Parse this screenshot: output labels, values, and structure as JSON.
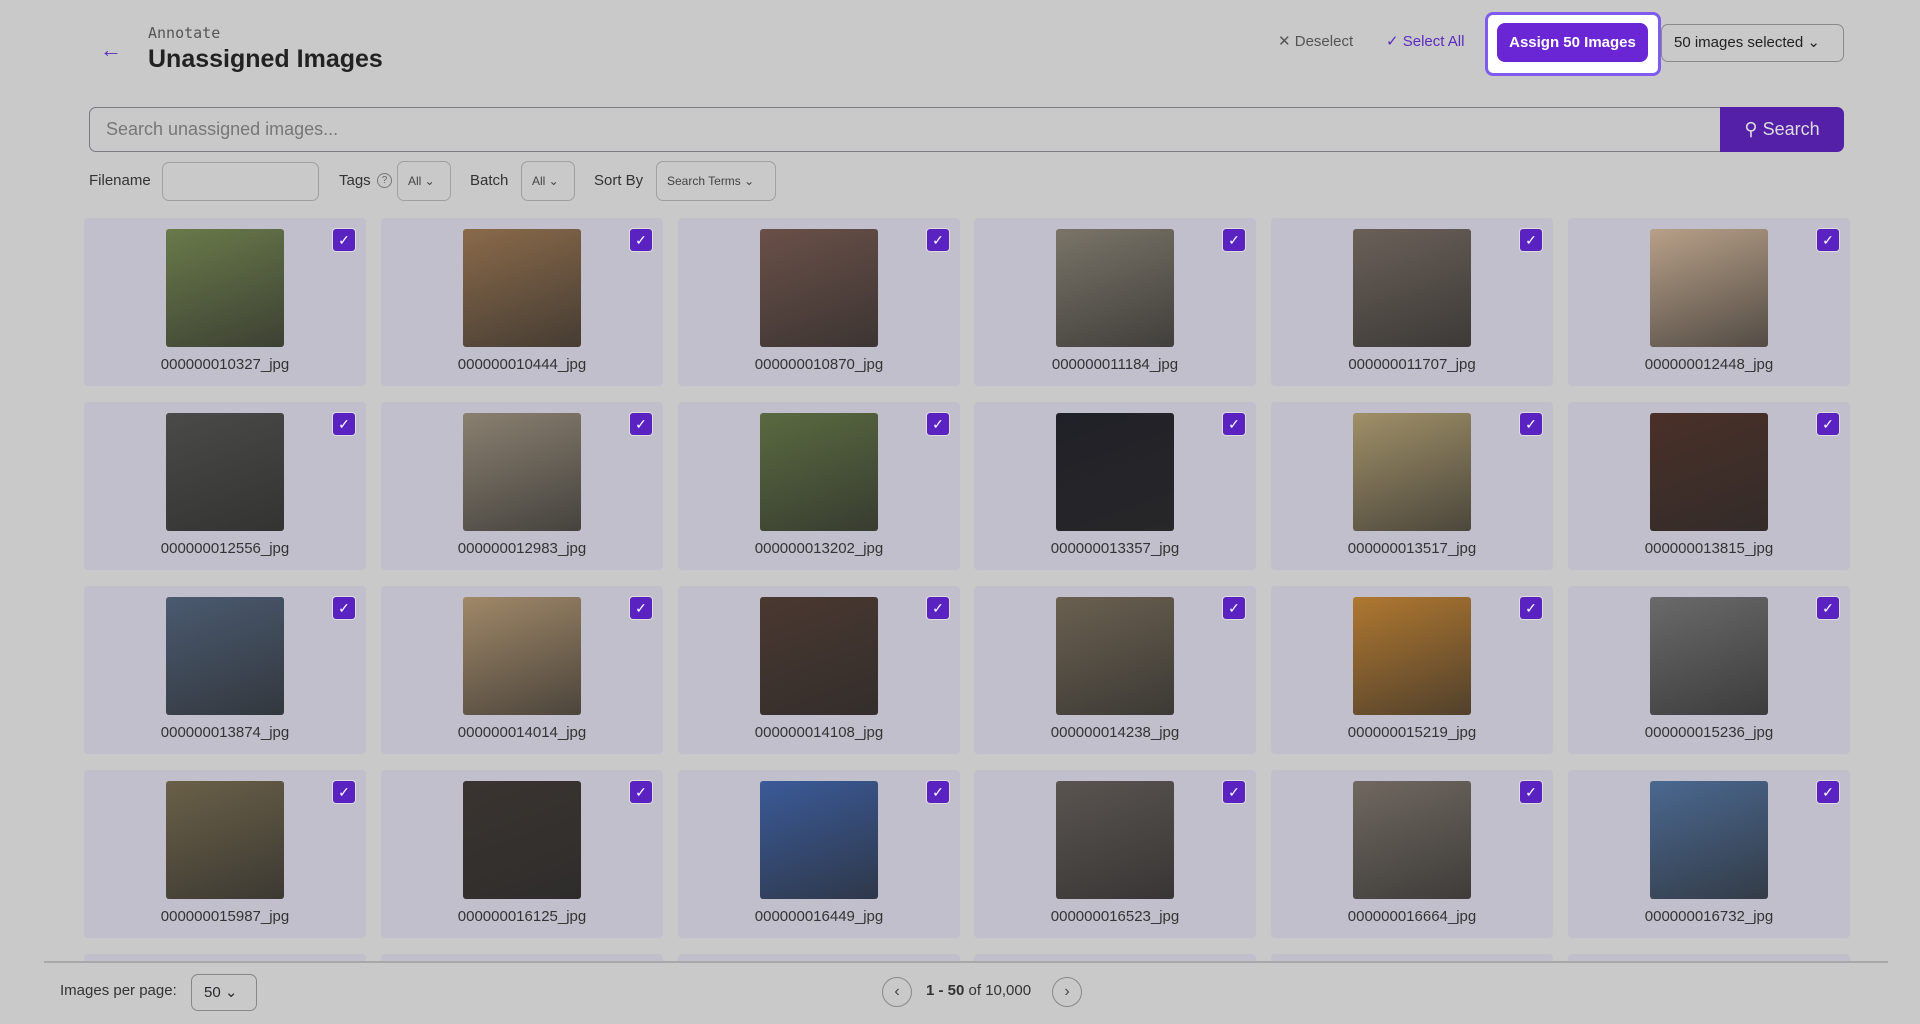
{
  "header": {
    "breadcrumb": "Annotate",
    "title": "Unassigned Images",
    "deselect": "Deselect",
    "select_all": "Select All",
    "assign": "Assign 50 Images",
    "selected": "50 images selected"
  },
  "search": {
    "placeholder": "Search unassigned images...",
    "button": "Search"
  },
  "filters": {
    "filename_label": "Filename",
    "tags_label": "Tags",
    "tags_value": "All",
    "batch_label": "Batch",
    "batch_value": "All",
    "sort_label": "Sort By",
    "sort_value": "Search Terms"
  },
  "images": [
    {
      "name": "000000010327_jpg",
      "color": "#6a7a4a"
    },
    {
      "name": "000000010444_jpg",
      "color": "#8a6a4a"
    },
    {
      "name": "000000010870_jpg",
      "color": "#6a5048"
    },
    {
      "name": "000000011184_jpg",
      "color": "#7a7468"
    },
    {
      "name": "000000011707_jpg",
      "color": "#6a6058"
    },
    {
      "name": "000000012448_jpg",
      "color": "#b8a088"
    },
    {
      "name": "000000012556_jpg",
      "color": "#4a4a48"
    },
    {
      "name": "000000012983_jpg",
      "color": "#8a8070"
    },
    {
      "name": "000000013202_jpg",
      "color": "#5a6a40"
    },
    {
      "name": "000000013357_jpg",
      "color": "#202028"
    },
    {
      "name": "000000013517_jpg",
      "color": "#a09068"
    },
    {
      "name": "000000013815_jpg",
      "color": "#4a3028"
    },
    {
      "name": "000000013874_jpg",
      "color": "#4a5a70"
    },
    {
      "name": "000000014014_jpg",
      "color": "#a08868"
    },
    {
      "name": "000000014108_jpg",
      "color": "#4a3830"
    },
    {
      "name": "000000014238_jpg",
      "color": "#6a6050"
    },
    {
      "name": "000000015219_jpg",
      "color": "#b07830"
    },
    {
      "name": "000000015236_jpg",
      "color": "#6a6a6a"
    },
    {
      "name": "000000015987_jpg",
      "color": "#6a6048"
    },
    {
      "name": "000000016125_jpg",
      "color": "#3a3430"
    },
    {
      "name": "000000016449_jpg",
      "color": "#3a5a98"
    },
    {
      "name": "000000016523_jpg",
      "color": "#5a5450"
    },
    {
      "name": "000000016664_jpg",
      "color": "#706860"
    },
    {
      "name": "000000016732_jpg",
      "color": "#4a6890"
    }
  ],
  "footer": {
    "per_page_label": "Images per page:",
    "per_page_value": "50",
    "range_bold": "1 - 50",
    "range_rest": "of 10,000"
  }
}
